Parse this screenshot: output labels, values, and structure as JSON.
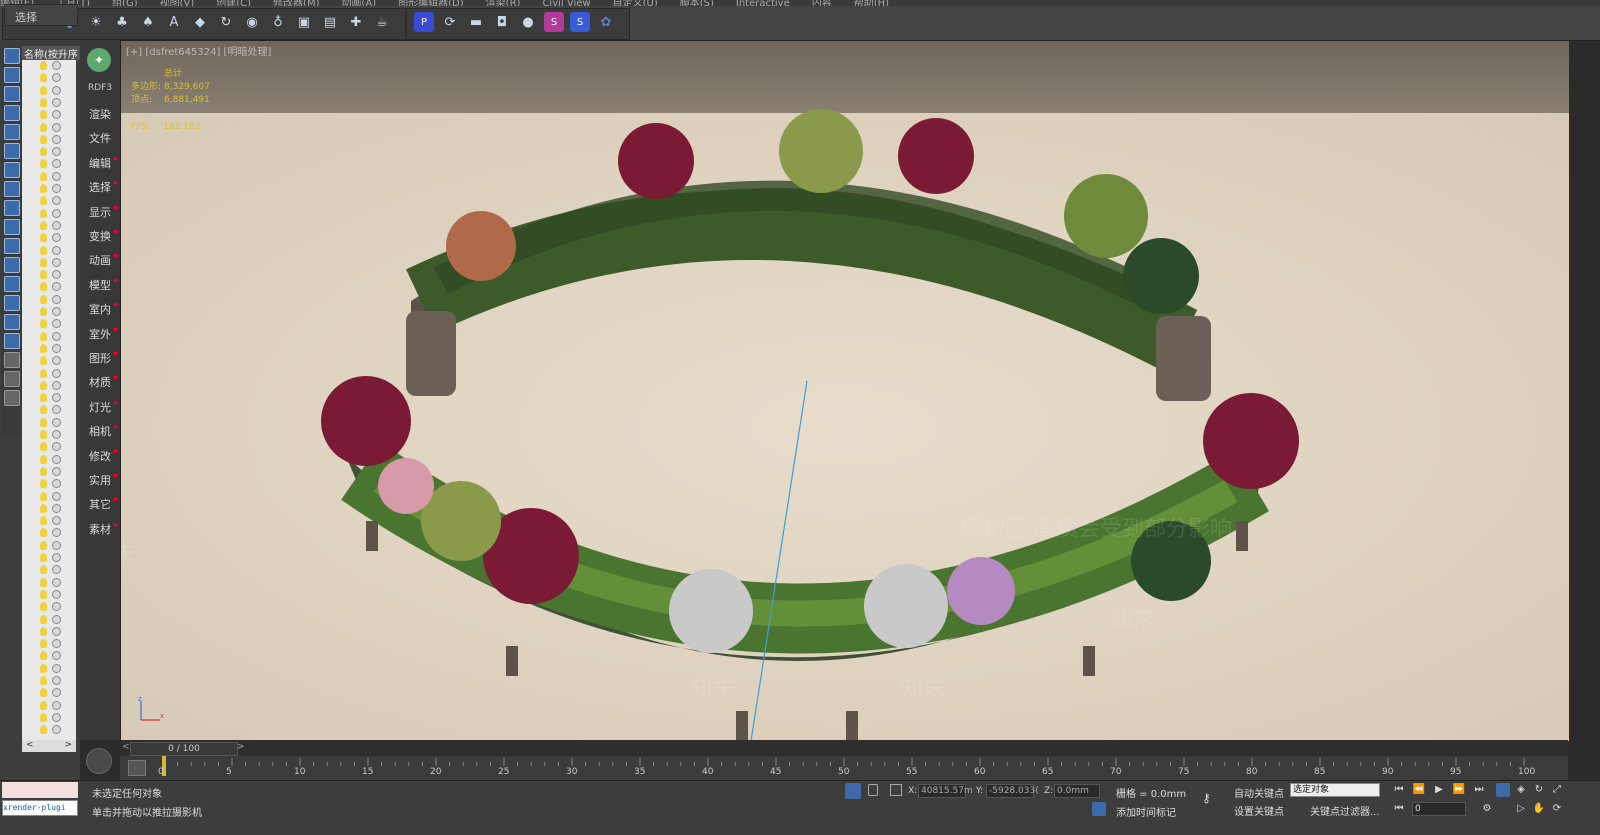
{
  "menubar": {
    "items": [
      "编辑(E)",
      "工具(T)",
      "组(G)",
      "视图(V)",
      "创建(C)",
      "修改器(M)",
      "动画(A)",
      "图形编辑器(D)",
      "渲染(R)",
      "Civil View",
      "自定义(U)",
      "脚本(S)",
      "Interactive",
      "内容",
      "帮助(H)"
    ]
  },
  "toolbar": {
    "icons": [
      "scene-explorer-icon",
      "layer-explorer-icon",
      "light-icon",
      "sun-icon",
      "tree-icon",
      "plant-icon",
      "text-icon",
      "paint-icon",
      "rotate-icon",
      "material-icon",
      "bulb-icon",
      "render-frame-icon",
      "render-setup-icon",
      "render-region-icon",
      "teapot-icon",
      "plugin-p-icon",
      "refresh-icon",
      "camera-icon",
      "capture-icon",
      "preview-icon",
      "skp-import-icon",
      "skp-export-icon",
      "settings-icon"
    ]
  },
  "left_panel": {
    "select_label": "选择",
    "name_column_header": "名称(按升序",
    "list_nav_prev": "<",
    "list_nav_next": ">"
  },
  "plugin": {
    "brand": "RDF3",
    "menu": [
      "渲染",
      "文件",
      "编辑",
      "选择",
      "显示",
      "变换",
      "动画",
      "模型",
      "室内",
      "室外",
      "图形",
      "材质",
      "灯光",
      "相机",
      "修改",
      "实用",
      "其它",
      "素材"
    ]
  },
  "viewport": {
    "label": "[+] [dsfret645324] [明暗处理]",
    "stats": {
      "total_label": "总计",
      "polys_label": "多边形:",
      "polys_value": "8,329,607",
      "verts_label": "顶点:",
      "verts_value": "6,881,491"
    },
    "fps_label": "FPS:",
    "fps_value": "182.102",
    "watermark_text": "知末",
    "protected_area_text": "保护区 画质会受到部分影响"
  },
  "timeline": {
    "frame_display": "0 / 100",
    "prev_arrow": "<",
    "next_arrow": ">",
    "tick_labels": [
      "0",
      "5",
      "10",
      "15",
      "20",
      "25",
      "30",
      "35",
      "40",
      "45",
      "50",
      "55",
      "60",
      "65",
      "70",
      "75",
      "80",
      "85",
      "90",
      "95",
      "100"
    ]
  },
  "status": {
    "maxscript_text": "xrender-plugi",
    "line1": "未选定任何对象",
    "line2": "单击并拖动以推拉摄影机",
    "x_label": "X:",
    "x_value": "40815.57m",
    "y_label": "Y:",
    "y_value": "-5928.033(",
    "z_label": "Z:",
    "z_value": "0.0mm",
    "grid_label": "栅格 = 0.0mm",
    "add_time_tag": "添加时间标记",
    "auto_key": "自动关键点",
    "set_key": "设置关键点",
    "selection_dropdown": "选定对象",
    "key_filters": "关键点过滤器...",
    "current_frame": "0"
  }
}
